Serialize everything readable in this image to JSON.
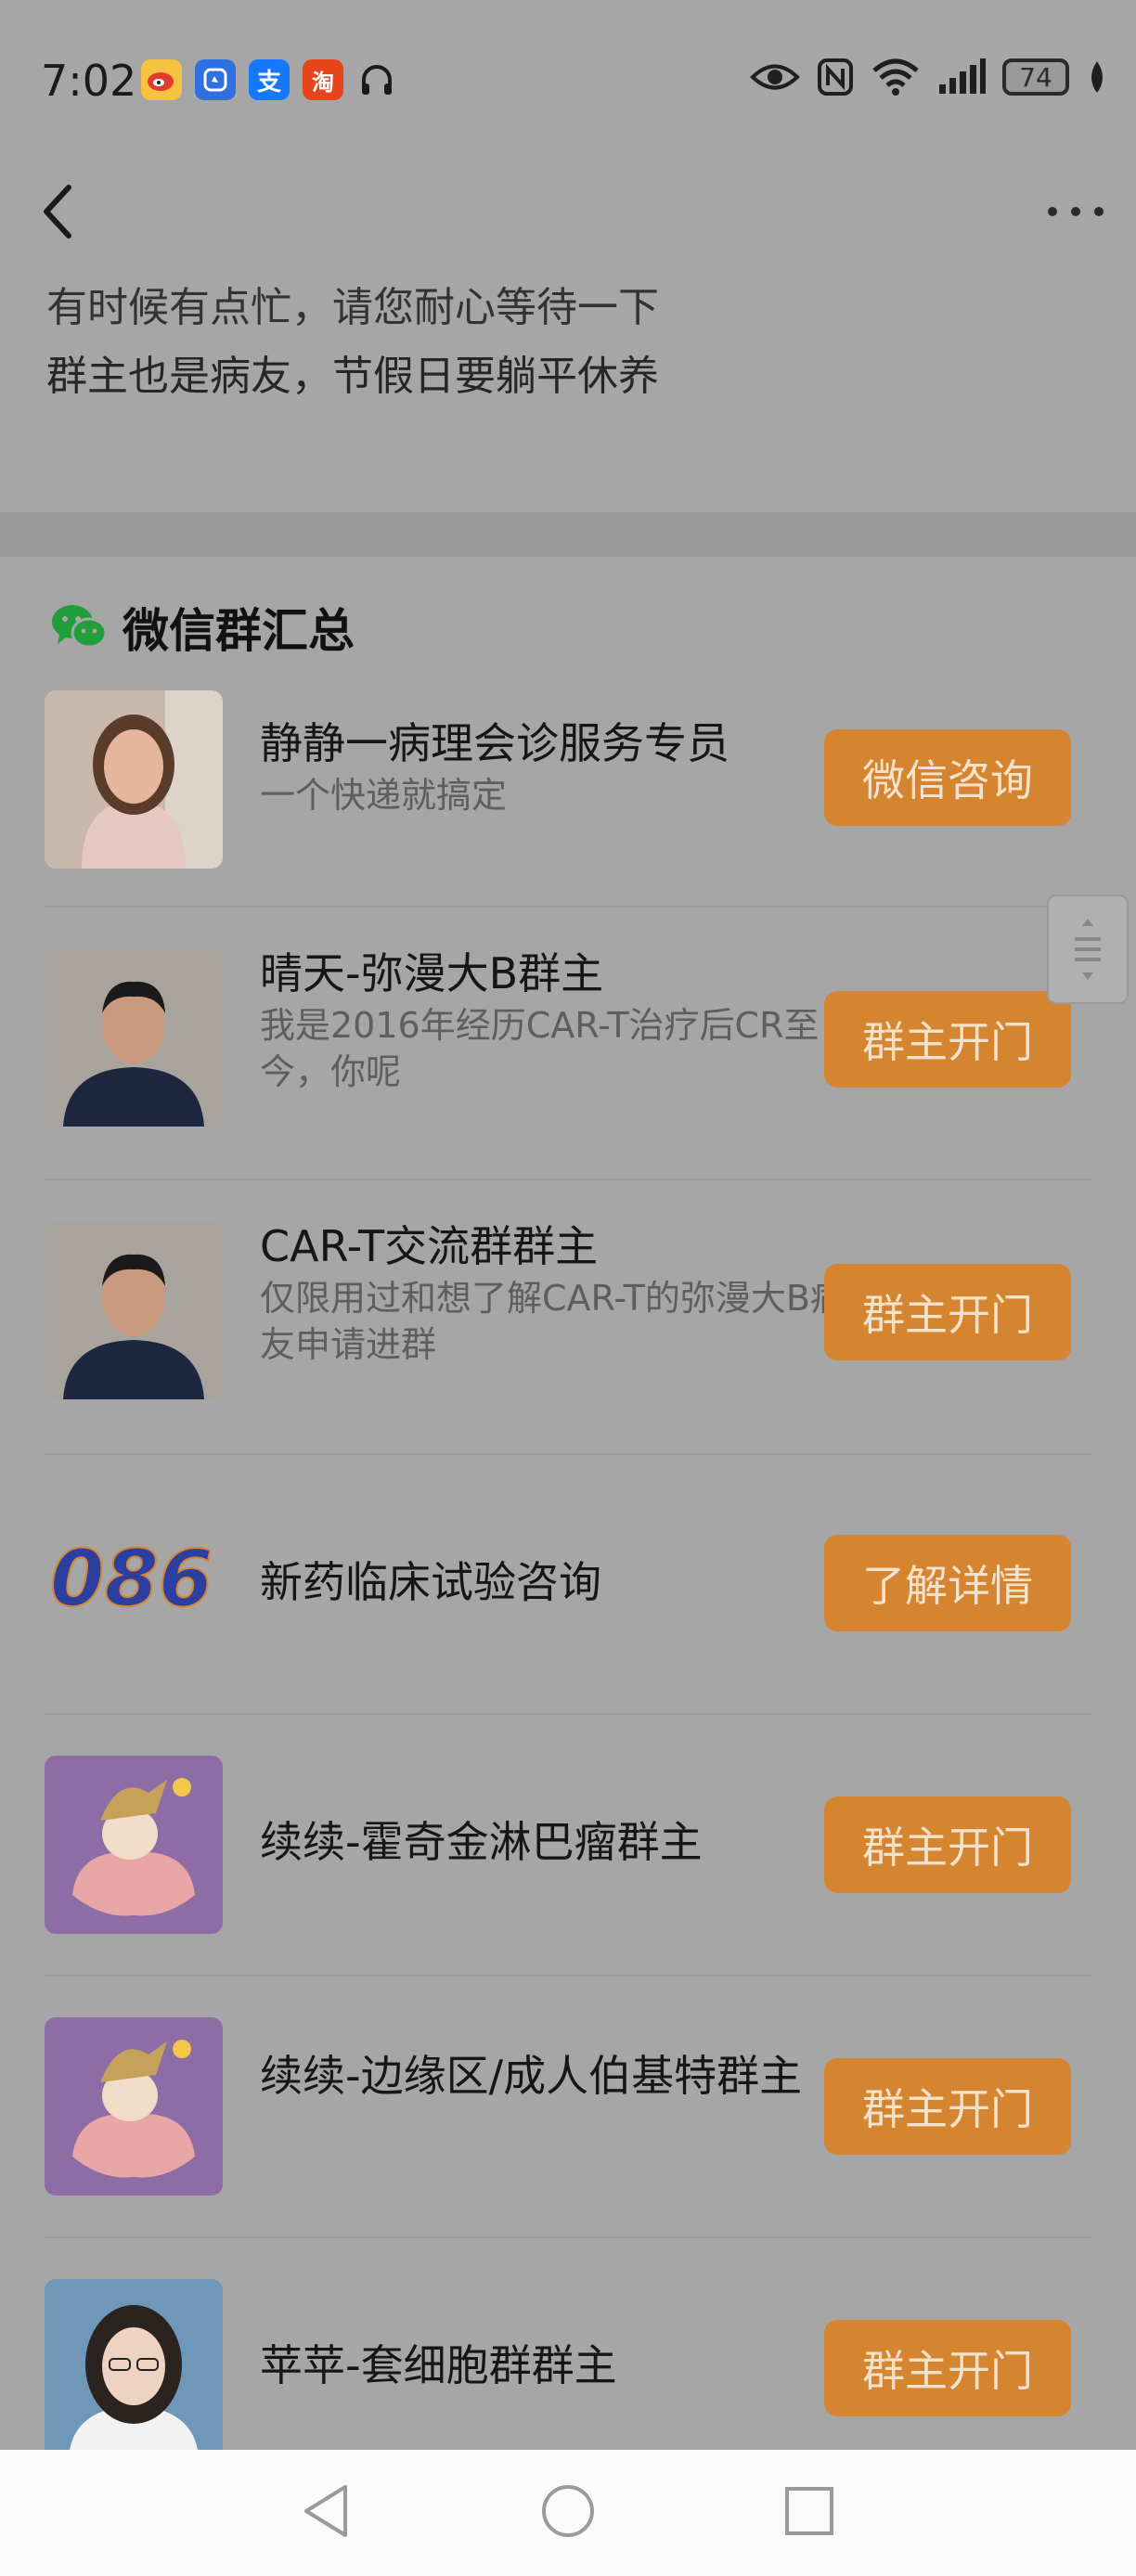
{
  "status_bar": {
    "time": "7:02",
    "left_icons": [
      {
        "name": "weibo-icon",
        "color": "#f5c242"
      },
      {
        "name": "lens-app-icon",
        "color": "#2f6fe0"
      },
      {
        "name": "alipay-icon",
        "color": "#1677ff",
        "glyph": "支"
      },
      {
        "name": "taobao-icon",
        "color": "#e8451c",
        "glyph": "淘"
      },
      {
        "name": "headphones-icon"
      }
    ],
    "right_icons": [
      "eye-icon",
      "nfc-icon",
      "wifi-icon",
      "signal-icon",
      "battery-icon",
      "leaf-icon"
    ],
    "battery_level": "74"
  },
  "header": {
    "back_icon": "chevron-left-icon",
    "more_icon": "more-dots-icon"
  },
  "notice": {
    "line1": "有时候有点忙，请您耐心等待一下",
    "line2": "群主也是病友，节假日要躺平休养"
  },
  "section": {
    "icon": "wechat-icon",
    "title": "微信群汇总"
  },
  "rows": [
    {
      "title": "静静一病理会诊服务专员",
      "subtitle": "一个快递就搞定",
      "button": "微信咨询"
    },
    {
      "title": "晴天-弥漫大B群主",
      "subtitle": "我是2016年经历CAR-T治疗后CR至今，你呢",
      "button": "群主开门"
    },
    {
      "title": "CAR-T交流群群主",
      "subtitle": "仅限用过和想了解CAR-T的弥漫大B病友申请进群",
      "button": "群主开门"
    },
    {
      "title": "新药临床试验咨询",
      "subtitle": "",
      "button": "了解详情",
      "logo_text": "086"
    },
    {
      "title": "续续-霍奇金淋巴瘤群主",
      "subtitle": "",
      "button": "群主开门"
    },
    {
      "title": "续续-边缘区/成人伯基特群主",
      "subtitle": "",
      "button": "群主开门"
    },
    {
      "title": "苹苹-套细胞群群主",
      "subtitle": "",
      "button": "群主开门"
    }
  ],
  "colors": {
    "button_bg": "#d5852f",
    "button_text": "#f4e2cc",
    "overlay_bg": "#a6a6a6"
  }
}
